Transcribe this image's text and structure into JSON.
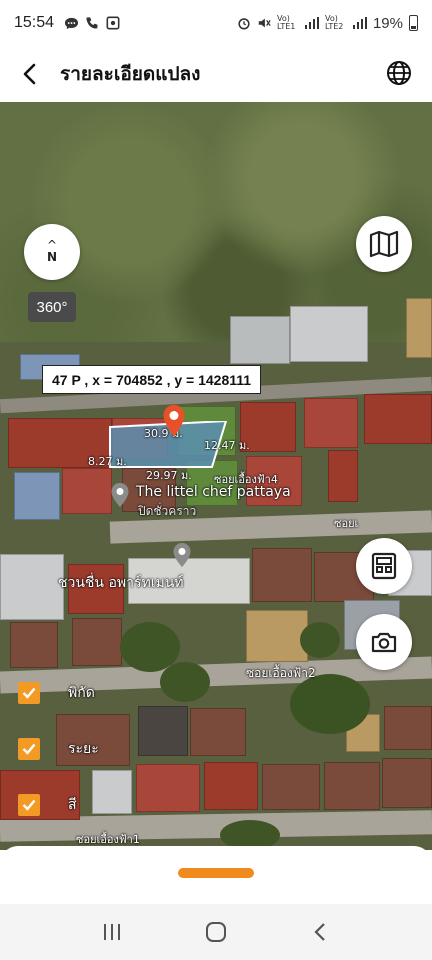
{
  "status_bar": {
    "time": "15:54",
    "left_icons": [
      "chat-icon",
      "phone-icon",
      "image-icon"
    ],
    "sim1_label": "Vo) LTE1",
    "sim2_label": "Vo) LTE2",
    "battery": "19%"
  },
  "header": {
    "title": "รายละเอียดแปลง",
    "back_icon": "chevron-left-icon",
    "right_icon": "globe-icon"
  },
  "map": {
    "coordinates": "47 P , x = 704852 , y = 1428111",
    "dimension_top": "30.9 ม.",
    "dimension_right": "12.47 ม.",
    "dimension_left": "8.27 ม.",
    "dimension_bottom": "29.97 ม.",
    "street_label_1": "ซอยเอื้องฟ้า4",
    "poi_name": "The littel chef pattaya",
    "poi_status": "ปิดชั่วคราว",
    "place_label": "ชวนชื่น อพาร์ทเมนท์",
    "street_label_2": "ซอยเอื้องฟ้า2",
    "street_label_3": "ซอยเอื้องฟ้า1",
    "street_label_4": "ซอยเ",
    "compass_label": "N",
    "view_360_label": "360°",
    "parcel_color": "#f39a24",
    "pin_color": "#e8502a"
  },
  "layers": [
    {
      "label": "พิกัด",
      "checked": true
    },
    {
      "label": "ระยะ",
      "checked": true
    },
    {
      "label": "สี",
      "checked": true
    }
  ],
  "fabs": {
    "map_type_icon": "map-icon",
    "dashboard_icon": "dashboard-icon",
    "camera_icon": "camera-icon"
  },
  "bottom_sheet": {
    "handle_color": "#f08a1c"
  },
  "navbar": {
    "recent_icon": "recent-apps-icon",
    "home_icon": "home-icon",
    "back_icon": "back-icon"
  }
}
